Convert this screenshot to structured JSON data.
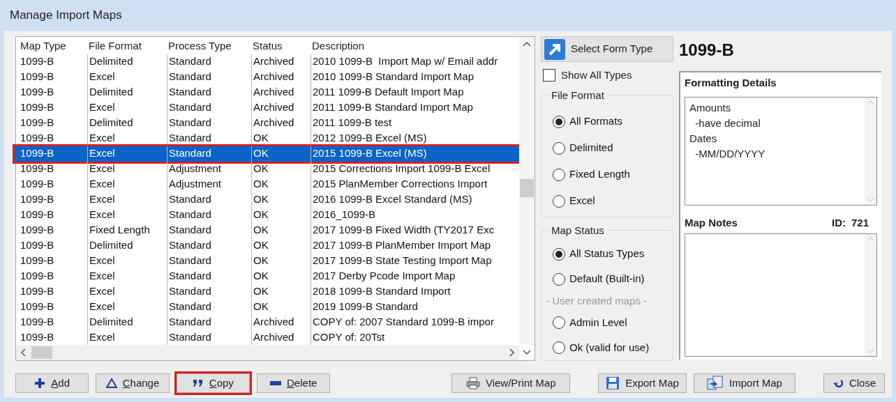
{
  "window": {
    "title": "Manage Import Maps"
  },
  "table": {
    "columns": [
      "Map Type",
      "File Format",
      "Process Type",
      "Status",
      "Description"
    ],
    "rows": [
      {
        "cells": [
          "1099-B",
          "Delimited",
          "Standard",
          "Archived",
          "2010 1099-B  Import Map w/ Email addr"
        ],
        "selected": false,
        "highlighted": false
      },
      {
        "cells": [
          "1099-B",
          "Excel",
          "Standard",
          "Archived",
          "2010 1099-B Standard Import Map"
        ],
        "selected": false,
        "highlighted": false
      },
      {
        "cells": [
          "1099-B",
          "Delimited",
          "Standard",
          "Archived",
          "2011 1099-B Default Import Map"
        ],
        "selected": false,
        "highlighted": false
      },
      {
        "cells": [
          "1099-B",
          "Excel",
          "Standard",
          "Archived",
          "2011 1099-B Standard Import Map"
        ],
        "selected": false,
        "highlighted": false
      },
      {
        "cells": [
          "1099-B",
          "Delimited",
          "Standard",
          "Archived",
          "2011 1099-B test"
        ],
        "selected": false,
        "highlighted": false
      },
      {
        "cells": [
          "1099-B",
          "Excel",
          "Standard",
          "OK",
          "2012 1099-B Excel (MS)"
        ],
        "selected": false,
        "highlighted": false
      },
      {
        "cells": [
          "1099-B",
          "Excel",
          "Standard",
          "OK",
          "2015 1099-B Excel (MS)"
        ],
        "selected": true,
        "highlighted": true
      },
      {
        "cells": [
          "1099-B",
          "Excel",
          "Adjustment",
          "OK",
          "2015 Corrections Import 1099-B Excel"
        ],
        "selected": false,
        "highlighted": false
      },
      {
        "cells": [
          "1099-B",
          "Excel",
          "Adjustment",
          "OK",
          "2015 PlanMember Corrections Import"
        ],
        "selected": false,
        "highlighted": false
      },
      {
        "cells": [
          "1099-B",
          "Excel",
          "Standard",
          "OK",
          "2016 1099-B Excel Standard (MS)"
        ],
        "selected": false,
        "highlighted": false
      },
      {
        "cells": [
          "1099-B",
          "Excel",
          "Standard",
          "OK",
          "2016_1099-B"
        ],
        "selected": false,
        "highlighted": false
      },
      {
        "cells": [
          "1099-B",
          "Fixed Length",
          "Standard",
          "OK",
          "2017 1099-B Fixed Width (TY2017 Exc"
        ],
        "selected": false,
        "highlighted": false
      },
      {
        "cells": [
          "1099-B",
          "Delimited",
          "Standard",
          "OK",
          "2017 1099-B PlanMember Import Map"
        ],
        "selected": false,
        "highlighted": false
      },
      {
        "cells": [
          "1099-B",
          "Excel",
          "Standard",
          "OK",
          "2017 1099-B State Testing Import Map"
        ],
        "selected": false,
        "highlighted": false
      },
      {
        "cells": [
          "1099-B",
          "Excel",
          "Standard",
          "OK",
          "2017 Derby Pcode Import Map"
        ],
        "selected": false,
        "highlighted": false
      },
      {
        "cells": [
          "1099-B",
          "Excel",
          "Standard",
          "OK",
          "2018 1099-B Standard Import"
        ],
        "selected": false,
        "highlighted": false
      },
      {
        "cells": [
          "1099-B",
          "Excel",
          "Standard",
          "OK",
          "2019 1099-B Standard"
        ],
        "selected": false,
        "highlighted": false
      },
      {
        "cells": [
          "1099-B",
          "Delimited",
          "Standard",
          "Archived",
          "COPY of: 2007 Standard 1099-B impor"
        ],
        "selected": false,
        "highlighted": false
      },
      {
        "cells": [
          "1099-B",
          "Excel",
          "Standard",
          "Archived",
          "COPY of: 20Tst"
        ],
        "selected": false,
        "highlighted": false
      }
    ]
  },
  "select_form_button": {
    "label": "Select Form Type"
  },
  "form_type": "1099-B",
  "show_all_types": {
    "label": "Show All Types",
    "checked": false
  },
  "file_format": {
    "title": "File Format",
    "options": [
      {
        "label": "All Formats",
        "selected": true
      },
      {
        "label": "Delimited",
        "selected": false
      },
      {
        "label": "Fixed Length",
        "selected": false
      },
      {
        "label": "Excel",
        "selected": false
      }
    ]
  },
  "map_status": {
    "title": "Map Status",
    "options": [
      {
        "kind": "radio",
        "label": "All Status Types",
        "selected": true
      },
      {
        "kind": "radio",
        "label": "Default (Built-in)",
        "selected": false
      },
      {
        "kind": "caption",
        "label": "- User created maps -"
      },
      {
        "kind": "radio",
        "label": "Admin Level",
        "selected": false
      },
      {
        "kind": "radio",
        "label": "Ok (valid for use)",
        "selected": false
      }
    ]
  },
  "formatting_details": {
    "title": "Formatting Details",
    "lines": [
      "Amounts",
      "  -have decimal",
      "Dates",
      "  -MM/DD/YYYY"
    ]
  },
  "map_notes": {
    "title": "Map Notes",
    "id_label": "ID:",
    "id": "721"
  },
  "buttons": [
    {
      "kind": "add",
      "label": "Add",
      "highlighted": false
    },
    {
      "kind": "change",
      "label": "Change",
      "highlighted": false
    },
    {
      "kind": "copy",
      "label": "Copy",
      "highlighted": true
    },
    {
      "kind": "delete",
      "label": "Delete",
      "highlighted": false
    },
    {
      "kind": "print",
      "label": "View/Print Map",
      "highlighted": false
    },
    {
      "kind": "export",
      "label": "Export Map",
      "highlighted": false
    },
    {
      "kind": "import",
      "label": "Import Map",
      "highlighted": false
    },
    {
      "kind": "close",
      "label": "Close",
      "highlighted": false
    }
  ]
}
